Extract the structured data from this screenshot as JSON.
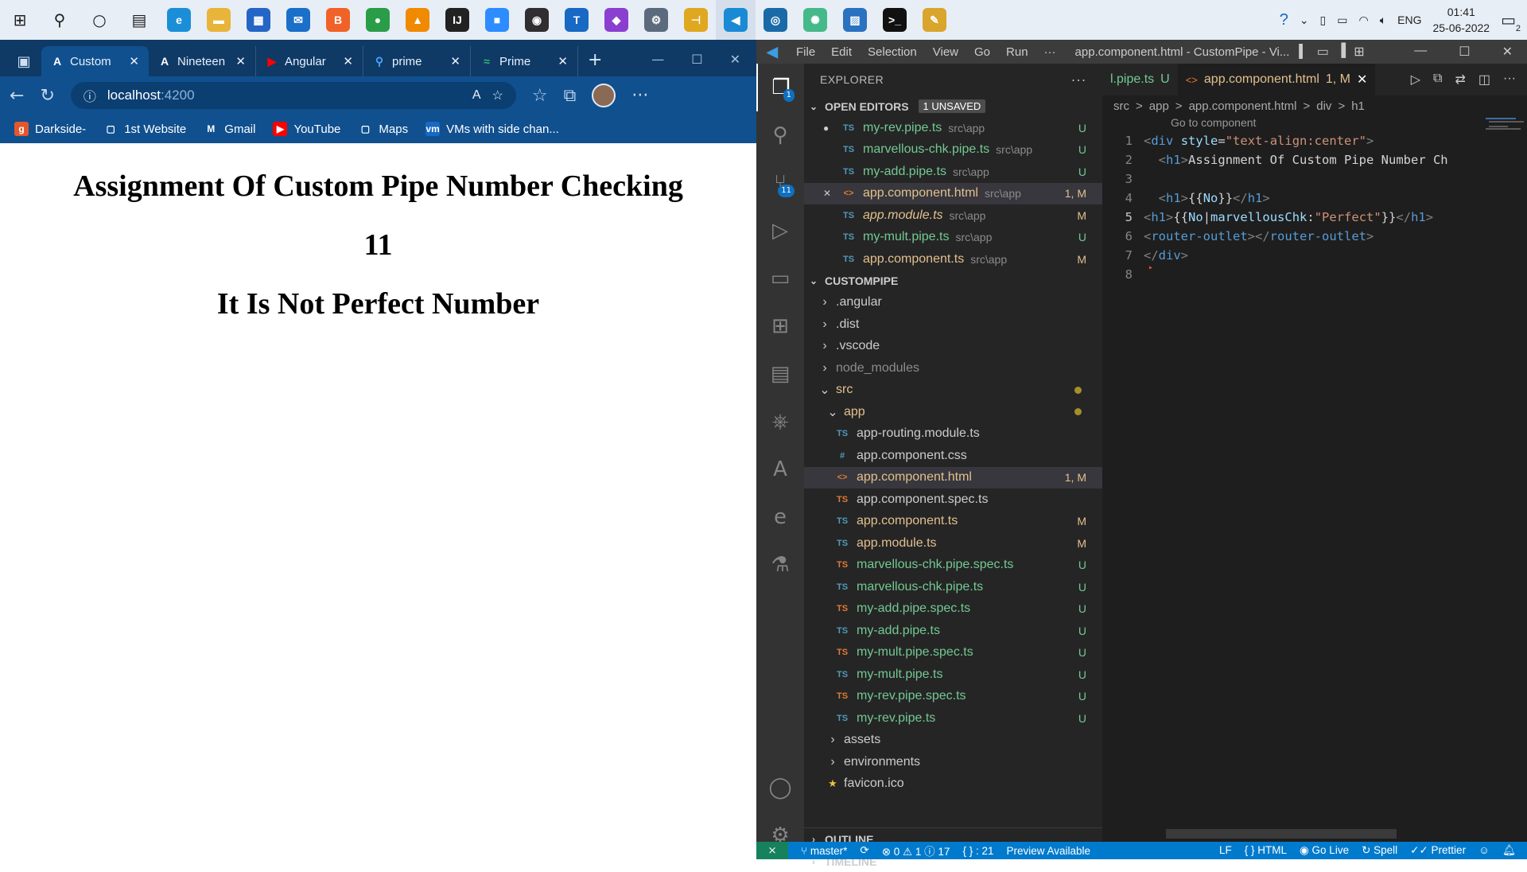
{
  "taskbar": {
    "icons": [
      {
        "name": "windows-start-icon",
        "glyph": "⊞",
        "color": "#1e1e1e"
      },
      {
        "name": "search-icon",
        "glyph": "⚲",
        "color": "#1e1e1e"
      },
      {
        "name": "cortana-icon",
        "glyph": "○",
        "color": "#1e1e1e"
      },
      {
        "name": "task-view-icon",
        "glyph": "▤",
        "color": "#1e1e1e"
      },
      {
        "name": "edge-icon",
        "glyph": "e",
        "color": "#1a8fd8"
      },
      {
        "name": "file-explorer-icon",
        "glyph": "▬",
        "color": "#e8b53a"
      },
      {
        "name": "store-icon",
        "glyph": "▦",
        "color": "#2465c6"
      },
      {
        "name": "mail-icon",
        "glyph": "✉",
        "color": "#1a6fc9"
      },
      {
        "name": "brave-icon",
        "glyph": "B",
        "color": "#f06228"
      },
      {
        "name": "chrome-icon",
        "glyph": "●",
        "color": "#2a9d48"
      },
      {
        "name": "vlc-icon",
        "glyph": "▲",
        "color": "#f08a00"
      },
      {
        "name": "intellij-icon",
        "glyph": "IJ",
        "color": "#222222"
      },
      {
        "name": "zoom-icon",
        "glyph": "■",
        "color": "#2d8cff"
      },
      {
        "name": "obs-icon",
        "glyph": "◉",
        "color": "#302e31"
      },
      {
        "name": "teams-icon",
        "glyph": "T",
        "color": "#1769c4"
      },
      {
        "name": "visual-studio-icon",
        "glyph": "◆",
        "color": "#8a3fd1"
      },
      {
        "name": "app-tool-icon",
        "glyph": "⚙",
        "color": "#5b6b7d"
      },
      {
        "name": "app-hierarchy-icon",
        "glyph": "⊣",
        "color": "#e0a820"
      },
      {
        "name": "vscode-icon",
        "glyph": "◀",
        "color": "#1a8ad5"
      },
      {
        "name": "app-disc-icon",
        "glyph": "◎",
        "color": "#1a6aa8"
      },
      {
        "name": "atom-icon",
        "glyph": "✺",
        "color": "#46b98a"
      },
      {
        "name": "photos-icon",
        "glyph": "▨",
        "color": "#2a71c0"
      },
      {
        "name": "terminal-icon",
        "glyph": ">_",
        "color": "#111111"
      },
      {
        "name": "paint-icon",
        "glyph": "✎",
        "color": "#d9a52c"
      }
    ],
    "tray": {
      "lang": "ENG",
      "time": "01:41",
      "date": "25-06-2022",
      "notif_count": "2"
    }
  },
  "browser": {
    "tabs": [
      {
        "label": "Custom",
        "fav": "A",
        "fav_color": "#ffffff",
        "active": true
      },
      {
        "label": "Nineteen",
        "fav": "A",
        "fav_color": "#ffffff",
        "active": false
      },
      {
        "label": "Angular",
        "fav": "▶",
        "fav_color": "#ff0000",
        "active": false
      },
      {
        "label": "prime",
        "fav": "⚲",
        "fav_color": "#4aa3ff",
        "active": false
      },
      {
        "label": "Prime",
        "fav": "≈",
        "fav_color": "#36b37e",
        "active": false
      }
    ],
    "url_host": "localhost",
    "url_port": ":4200",
    "bookmarks": [
      {
        "label": "Darkside-",
        "icon": "g",
        "bg": "#e4572e"
      },
      {
        "label": "1st Website",
        "icon": "▢",
        "bg": "transparent"
      },
      {
        "label": "Gmail",
        "icon": "M",
        "bg": "transparent"
      },
      {
        "label": "YouTube",
        "icon": "▶",
        "bg": "#ff0000"
      },
      {
        "label": "Maps",
        "icon": "▢",
        "bg": "transparent"
      },
      {
        "label": "VMs with side chan...",
        "icon": "vm",
        "bg": "#1769c4"
      }
    ],
    "page": {
      "heading": "Assignment Of Custom Pipe Number Checking",
      "number": "11",
      "result": "It Is Not Perfect Number"
    }
  },
  "vscode": {
    "menu": [
      "File",
      "Edit",
      "Selection",
      "View",
      "Go",
      "Run",
      "···"
    ],
    "title": "app.component.html - CustomPipe - Vi...",
    "explorer_title": "EXPLORER",
    "open_editors_label": "OPEN EDITORS",
    "unsaved_badge": "1 UNSAVED",
    "open_editors": [
      {
        "name": "my-rev.pipe.ts",
        "path": "src\\app",
        "status": "U",
        "type": "ts",
        "dot": true
      },
      {
        "name": "marvellous-chk.pipe.ts",
        "path": "src\\app",
        "status": "U",
        "type": "ts"
      },
      {
        "name": "my-add.pipe.ts",
        "path": "src\\app",
        "status": "U",
        "type": "ts"
      },
      {
        "name": "app.component.html",
        "path": "src\\app",
        "status": "1, M",
        "type": "html",
        "close": true,
        "selected": true
      },
      {
        "name": "app.module.ts",
        "path": "src\\app",
        "status": "M",
        "type": "ts",
        "italic": true
      },
      {
        "name": "my-mult.pipe.ts",
        "path": "src\\app",
        "status": "U",
        "type": "ts"
      },
      {
        "name": "app.component.ts",
        "path": "src\\app",
        "status": "M",
        "type": "ts"
      }
    ],
    "project_label": "CUSTOMPIPE",
    "tree": [
      {
        "name": ".angular",
        "kind": "folder",
        "depth": 1
      },
      {
        "name": ".dist",
        "kind": "folder",
        "depth": 1
      },
      {
        "name": ".vscode",
        "kind": "folder",
        "depth": 1
      },
      {
        "name": "node_modules",
        "kind": "folder",
        "depth": 1,
        "dim": true
      },
      {
        "name": "src",
        "kind": "folder-open",
        "depth": 1,
        "dot": true,
        "color": "#e2c08d"
      },
      {
        "name": "app",
        "kind": "folder-open",
        "depth": 2,
        "dot": true,
        "color": "#e2c08d"
      },
      {
        "name": "app-routing.module.ts",
        "kind": "ts",
        "depth": 3,
        "status": ""
      },
      {
        "name": "app.component.css",
        "kind": "css",
        "depth": 3,
        "status": ""
      },
      {
        "name": "app.component.html",
        "kind": "html",
        "depth": 3,
        "status": "1, M",
        "selected": true
      },
      {
        "name": "app.component.spec.ts",
        "kind": "spec",
        "depth": 3,
        "status": ""
      },
      {
        "name": "app.component.ts",
        "kind": "ts",
        "depth": 3,
        "status": "M"
      },
      {
        "name": "app.module.ts",
        "kind": "ts",
        "depth": 3,
        "status": "M"
      },
      {
        "name": "marvellous-chk.pipe.spec.ts",
        "kind": "spec",
        "depth": 3,
        "status": "U"
      },
      {
        "name": "marvellous-chk.pipe.ts",
        "kind": "ts",
        "depth": 3,
        "status": "U"
      },
      {
        "name": "my-add.pipe.spec.ts",
        "kind": "spec",
        "depth": 3,
        "status": "U"
      },
      {
        "name": "my-add.pipe.ts",
        "kind": "ts",
        "depth": 3,
        "status": "U"
      },
      {
        "name": "my-mult.pipe.spec.ts",
        "kind": "spec",
        "depth": 3,
        "status": "U"
      },
      {
        "name": "my-mult.pipe.ts",
        "kind": "ts",
        "depth": 3,
        "status": "U"
      },
      {
        "name": "my-rev.pipe.spec.ts",
        "kind": "spec",
        "depth": 3,
        "status": "U"
      },
      {
        "name": "my-rev.pipe.ts",
        "kind": "ts",
        "depth": 3,
        "status": "U"
      },
      {
        "name": "assets",
        "kind": "folder",
        "depth": 2
      },
      {
        "name": "environments",
        "kind": "folder",
        "depth": 2
      },
      {
        "name": "favicon.ico",
        "kind": "star",
        "depth": 2
      }
    ],
    "outline_label": "OUTLINE",
    "timeline_label": "TIMELINE",
    "editor_tabs": [
      {
        "label": "l.pipe.ts",
        "status": "U",
        "active": false
      },
      {
        "label": "app.component.html",
        "status": "1, M",
        "active": true
      }
    ],
    "breadcrumbs": [
      "src",
      ">",
      "app",
      ">",
      "app.component.html",
      ">",
      "div",
      ">",
      "h1"
    ],
    "codelens": "Go to component",
    "code_lines": [
      {
        "n": "1",
        "html": "<span class='k-pun'>&lt;</span><span class='k-tag'>div</span> <span class='k-attr'>style</span><span class='k-txt'>=</span><span class='k-str'>\"text-align:center\"</span><span class='k-pun'>&gt;</span>"
      },
      {
        "n": "2",
        "html": "  <span class='k-pun'>&lt;</span><span class='k-tag'>h1</span><span class='k-pun'>&gt;</span><span class='k-txt'>Assignment Of Custom Pipe Number Ch</span>"
      },
      {
        "n": "3",
        "html": ""
      },
      {
        "n": "4",
        "html": "  <span class='k-pun'>&lt;</span><span class='k-tag'>h1</span><span class='k-pun'>&gt;</span><span class='k-txt'>{{</span><span class='k-var'>No</span><span class='k-txt'>}}</span><span class='k-pun'>&lt;/</span><span class='k-tag'>h1</span><span class='k-pun'>&gt;</span>"
      },
      {
        "n": "5",
        "html": "<span class='k-pun'>&lt;</span><span class='k-tag'>h1</span><span class='k-pun'>&gt;</span><span class='k-txt'>{{</span><span class='k-var'>No</span><span class='k-txt'>|</span><span class='k-var'>marvellousChk</span><span class='k-txt'>:</span><span class='k-str'>\"Perfect\"</span><span class='k-txt'>}}</span><span class='k-pun'>&lt;/</span><span class='k-tag'>h1</span><span class='k-pun'>&gt;</span>",
        "cur": true
      },
      {
        "n": "6",
        "html": "<span class='k-pun'>&lt;</span><span class='k-tag'>router-outlet</span><span class='k-pun'>&gt;&lt;/</span><span class='k-tag'>router-outlet</span><span class='k-pun'>&gt;</span>"
      },
      {
        "n": "7",
        "html": "<span class='k-pun'>&lt;/</span><span class='k-tag'>div</span><span class='k-pun'>&gt;</span>"
      },
      {
        "n": "8",
        "html": ""
      }
    ],
    "status": {
      "branch": "master*",
      "errors": "0",
      "warnings": "1",
      "infos": "17",
      "braces": "{ } : 21",
      "preview": "Preview Available",
      "eol": "LF",
      "lang": "HTML",
      "golive": "Go Live",
      "spell": "Spell",
      "prettier": "Prettier"
    },
    "activity_badges": {
      "source_control": "11",
      "explorer": "1"
    }
  }
}
